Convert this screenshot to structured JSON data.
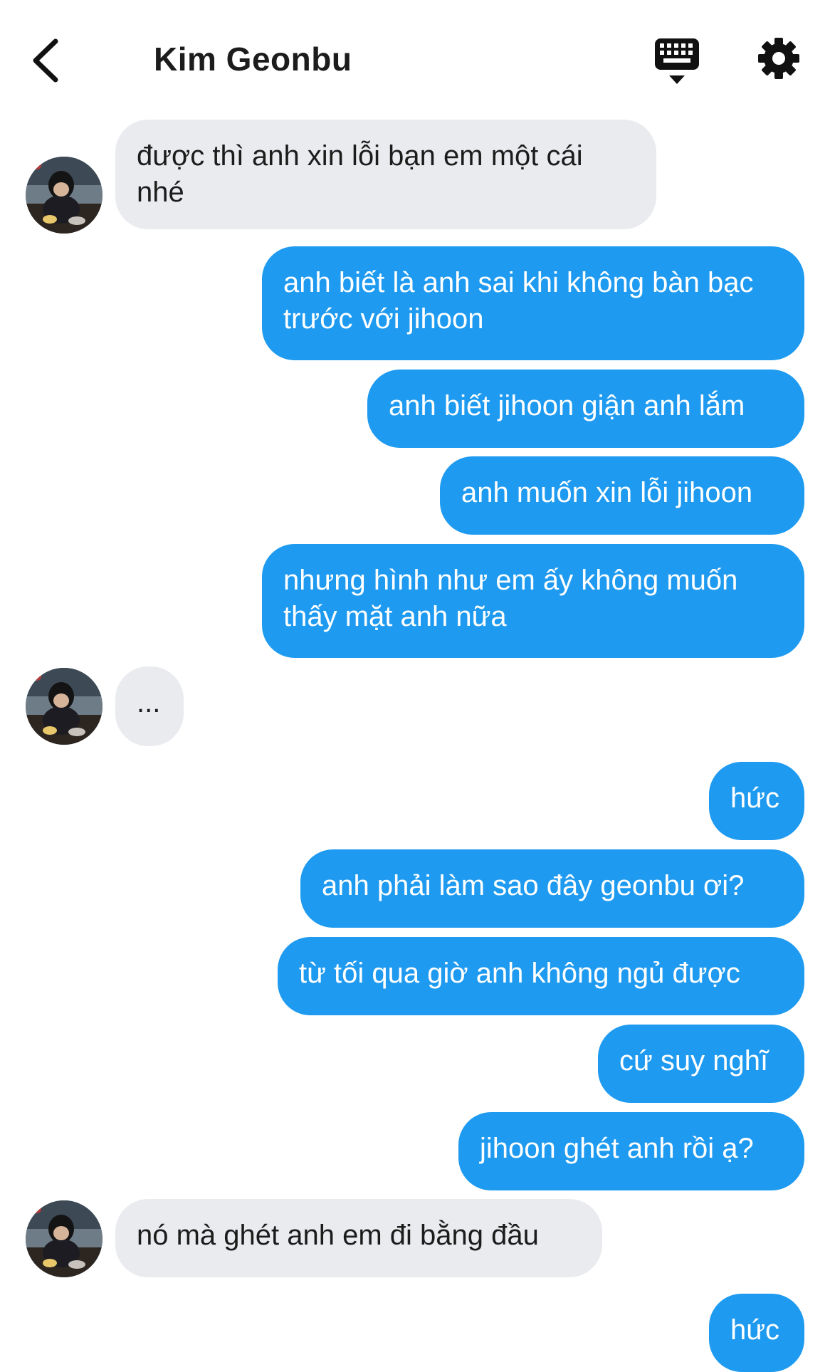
{
  "header": {
    "title": "Kim Geonbu",
    "back_icon": "chevron-left-icon",
    "keyboard_icon": "keyboard-icon",
    "settings_icon": "gear-icon"
  },
  "colors": {
    "outgoing_bubble": "#1e9af0",
    "incoming_bubble": "#e9ebee",
    "text_dark": "#1c1c1c"
  },
  "messages": [
    {
      "from": "them",
      "text": "được thì anh xin lỗi bạn em một cái nhé"
    },
    {
      "from": "me",
      "text": "anh biết là anh sai khi không bàn bạc trước với jihoon"
    },
    {
      "from": "me",
      "text": "anh biết jihoon giận anh lắm"
    },
    {
      "from": "me",
      "text": "anh muốn xin lỗi jihoon"
    },
    {
      "from": "me",
      "text": "nhưng hình như em ấy không muốn thấy mặt anh nữa"
    },
    {
      "from": "them",
      "text": "..."
    },
    {
      "from": "me",
      "text": "hức"
    },
    {
      "from": "me",
      "text": "anh phải làm sao đây geonbu ơi?"
    },
    {
      "from": "me",
      "text": "từ tối qua giờ anh không ngủ được"
    },
    {
      "from": "me",
      "text": "cứ suy nghĩ"
    },
    {
      "from": "me",
      "text": "jihoon ghét anh rồi ạ?"
    },
    {
      "from": "them",
      "text": "nó mà ghét anh em đi bằng đầu"
    },
    {
      "from": "me",
      "text": "hức"
    }
  ]
}
